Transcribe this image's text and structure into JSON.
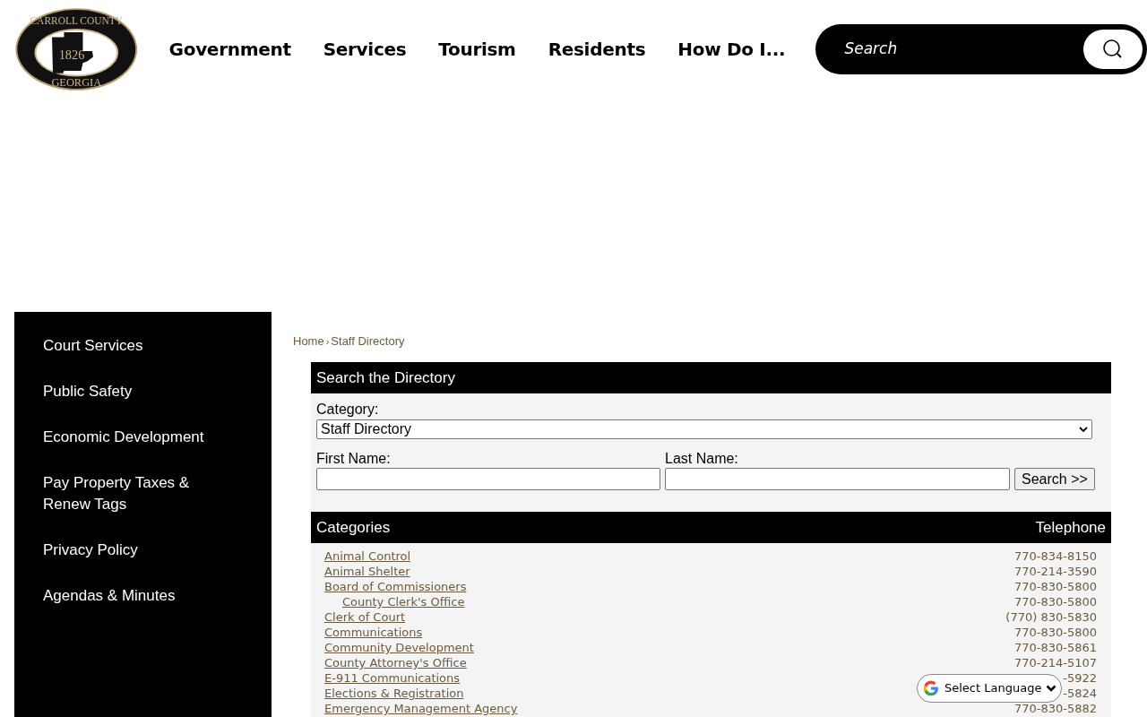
{
  "logo": {
    "top_text": "CARROLL COUNTY",
    "year": "1826",
    "bottom_text": "GEORGIA"
  },
  "nav": [
    "Government",
    "Services",
    "Tourism",
    "Residents",
    "How Do I..."
  ],
  "search": {
    "placeholder": "Search"
  },
  "sidebar": {
    "items": [
      "Court Services",
      "Public Safety",
      "Economic Development",
      "Pay Property Taxes & Renew Tags",
      "Privacy Policy",
      "Agendas & Minutes"
    ]
  },
  "breadcrumb": {
    "items": [
      "Home",
      "Staff Directory"
    ],
    "separator": "›"
  },
  "search_panel": {
    "title": "Search the Directory",
    "category_label": "Category:",
    "category_value": "Staff Directory",
    "first_name_label": "First Name:",
    "last_name_label": "Last Name:",
    "button": "Search >>"
  },
  "table": {
    "columns": [
      "Categories",
      "Telephone"
    ],
    "rows": [
      {
        "name": "Animal Control",
        "phone": "770-834-8150"
      },
      {
        "name": "Animal Shelter",
        "phone": "770-214-3590"
      },
      {
        "name": "Board of Commissioners",
        "phone": "770-830-5800",
        "children": [
          {
            "name": "County Clerk's Office",
            "phone": "770-830-5800"
          }
        ]
      },
      {
        "name": "Clerk of Court",
        "phone": "(770) 830-5830"
      },
      {
        "name": "Communications",
        "phone": "770-830-5800"
      },
      {
        "name": "Community Development",
        "phone": "770-830-5861"
      },
      {
        "name": "County Attorney's Office",
        "phone": "770-214-5107"
      },
      {
        "name": "E-911 Communications",
        "phone": "-5922"
      },
      {
        "name": "Elections & Registration",
        "phone": "-5824"
      },
      {
        "name": "Emergency Management Agency",
        "phone": "770-830-5882"
      }
    ]
  },
  "language_widget": {
    "label": "Select Language"
  }
}
